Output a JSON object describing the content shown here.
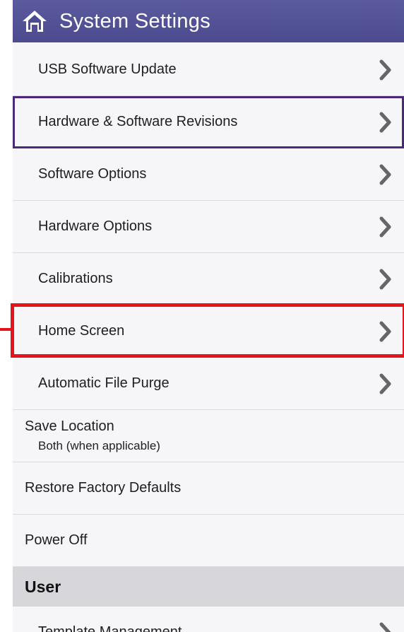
{
  "header": {
    "title": "System Settings",
    "icon": "home-icon"
  },
  "items": [
    {
      "label": "USB Software Update",
      "chevron": true
    },
    {
      "label": "Hardware & Software Revisions",
      "chevron": true,
      "selected": true
    },
    {
      "label": "Software Options",
      "chevron": true
    },
    {
      "label": "Hardware Options",
      "chevron": true
    },
    {
      "label": "Calibrations",
      "chevron": true
    },
    {
      "label": "Home Screen",
      "chevron": true,
      "highlighted": true
    },
    {
      "label": "Automatic File Purge",
      "chevron": true
    },
    {
      "label": "Save Location",
      "value": "Both (when applicable)"
    },
    {
      "label": "Restore Factory Defaults"
    },
    {
      "label": "Power Off"
    }
  ],
  "section_user": {
    "label": "User",
    "items": [
      {
        "label": "Template Management",
        "chevron": true
      }
    ]
  },
  "colors": {
    "header_bg": "#4c4b8f",
    "selected_border": "#4a2a78",
    "annotation_red": "#e5131a",
    "section_bg": "#d7d7db"
  }
}
